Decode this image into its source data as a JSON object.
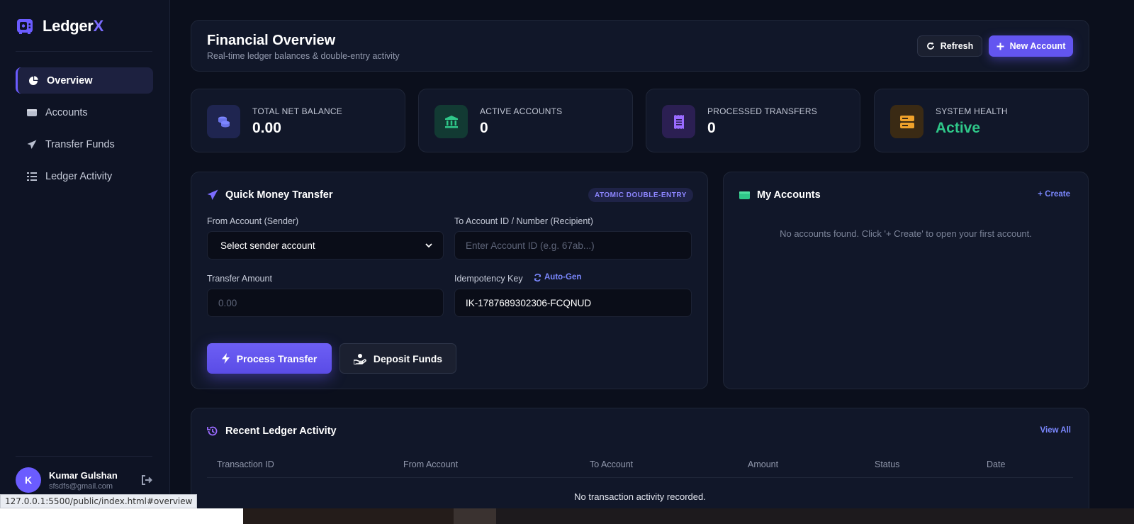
{
  "brand": {
    "name_main": "Ledger",
    "name_accent": "X"
  },
  "sidebar": {
    "items": [
      {
        "label": "Overview",
        "icon": "pie-chart-icon"
      },
      {
        "label": "Accounts",
        "icon": "wallet-icon"
      },
      {
        "label": "Transfer Funds",
        "icon": "paper-plane-icon"
      },
      {
        "label": "Ledger Activity",
        "icon": "list-icon"
      }
    ],
    "user": {
      "initial": "K",
      "name": "Kumar Gulshan",
      "email": "sfsdfs@gmail.com"
    }
  },
  "header": {
    "title": "Financial Overview",
    "subtitle": "Real-time ledger balances & double-entry activity",
    "refresh_label": "Refresh",
    "new_account_label": "New Account"
  },
  "stats": [
    {
      "label": "Total Net Balance",
      "value": "0.00",
      "icon": "coins-icon",
      "color": "#7c86ff"
    },
    {
      "label": "Active Accounts",
      "value": "0",
      "icon": "bank-icon",
      "color": "#2fc789"
    },
    {
      "label": "Processed Transfers",
      "value": "0",
      "icon": "receipt-icon",
      "color": "#9a6bff"
    },
    {
      "label": "System Health",
      "value": "Active",
      "icon": "server-icon",
      "color": "#f0a22b"
    }
  ],
  "transfer": {
    "title": "Quick Money Transfer",
    "badge": "ATOMIC DOUBLE-ENTRY",
    "from_label": "From Account (Sender)",
    "from_value": "Select sender account",
    "to_label": "To Account ID / Number (Recipient)",
    "to_placeholder": "Enter Account ID (e.g. 67ab...)",
    "amount_label": "Transfer Amount",
    "amount_placeholder": "0.00",
    "key_label": "Idempotency Key",
    "autogen_label": "Auto-Gen",
    "key_value": "IK-1787689302306-FCQNUD",
    "process_label": "Process Transfer",
    "deposit_label": "Deposit Funds"
  },
  "accounts": {
    "title": "My Accounts",
    "create_label": "+ Create",
    "empty": "No accounts found. Click '+ Create' to open your first account."
  },
  "activity": {
    "title": "Recent Ledger Activity",
    "view_all": "View All",
    "columns": [
      "Transaction ID",
      "From Account",
      "To Account",
      "Amount",
      "Status",
      "Date"
    ],
    "empty": "No transaction activity recorded."
  },
  "statusbar": {
    "url": "127.0.0.1:5500/public/index.html#overview"
  },
  "colors": {
    "accent": "#6355f0",
    "success": "#2fc789",
    "background": "#0b0f1c"
  }
}
